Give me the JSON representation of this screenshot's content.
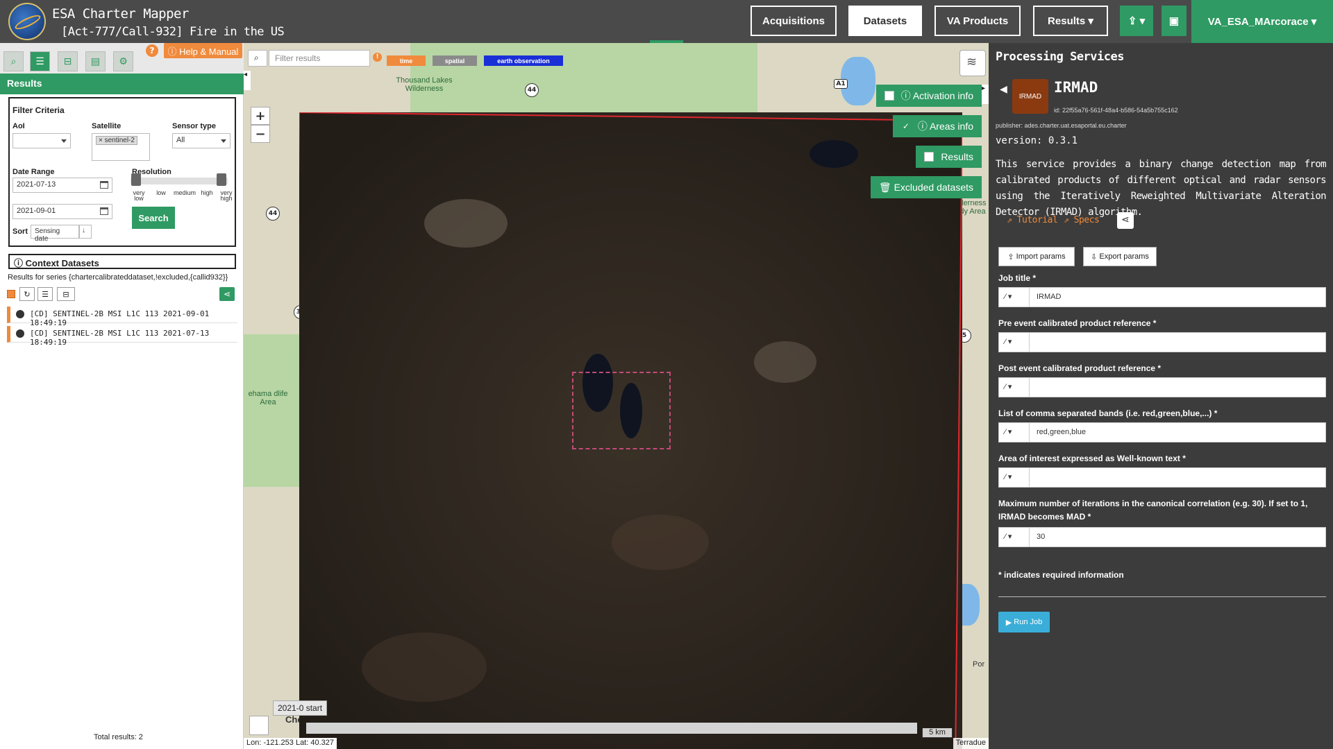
{
  "header": {
    "app_title": "ESA Charter Mapper",
    "activation_title": "[Act-777/Call-932] Fire in the US",
    "nav": {
      "acquisitions": "Acquisitions",
      "datasets": "Datasets",
      "va_products": "VA Products",
      "results": "Results ▾"
    },
    "upload_icon": "upload-icon",
    "briefcase_icon": "briefcase-icon",
    "user": "VA_ESA_MArcorace ▾"
  },
  "left_panel": {
    "help_label": "?",
    "help_manual": "ⓘ Help & Manual",
    "results_header": "Results",
    "filter": {
      "title": "Filter Criteria",
      "aoi_label": "AoI",
      "satellite_label": "Satellite",
      "satellite_value": "× sentinel-2",
      "sensor_label": "Sensor type",
      "sensor_value": "All",
      "date_range_label": "Date Range",
      "date_from": "2021-07-13",
      "date_to": "2021-09-01",
      "resolution_label": "Resolution",
      "resolution_ticks": [
        "very low",
        "low",
        "medium",
        "high",
        "very high"
      ],
      "sort_label": "Sort",
      "sort_value": "Sensing date",
      "sort_dir": "↓",
      "search_button": "Search"
    },
    "context_datasets": "ⓘ Context Datasets",
    "series_text": "Results for series {chartercalibrateddataset,!excluded,{callid932}}",
    "results": [
      "[CD] SENTINEL-2B MSI L1C 113 2021-09-01 18:49:19",
      "[CD] SENTINEL-2B MSI L1C 113 2021-07-13 18:49:19"
    ],
    "total_results": "Total results: 2"
  },
  "map": {
    "filter_placeholder": "Filter results",
    "tags": {
      "time": "time",
      "spatial": "spatial",
      "eo": "earth observation"
    },
    "zoom_in": "+",
    "zoom_out": "−",
    "toggles": {
      "activation_info": "ⓘ Activation info",
      "areas_info": "ⓘ Areas info",
      "results": "Results",
      "excluded": "🗑 Excluded datasets"
    },
    "labels": {
      "thousand_lakes": "Thousand Lakes Wilderness",
      "tehama": "ehama dlife Area",
      "wilderness_right": "derness dy Area",
      "chester": "Che",
      "por": "Por"
    },
    "roads": [
      "44",
      "44",
      "A1",
      "36",
      "5"
    ],
    "timeline_label": "2021-0 start",
    "coords": "Lon: -121.253 Lat: 40.327",
    "scale": "5 km",
    "attribution": "Terradue"
  },
  "right_panel": {
    "title": "Processing Services",
    "service": {
      "logo_text": "IRMAD",
      "name": "IRMAD",
      "id": "id: 22f55a76-561f-48a4-b586-54a5b755c162",
      "publisher": "publisher: ades.charter.uat.esaportal.eu.charter",
      "version": "version: 0.3.1",
      "description": "This service provides a binary change detection map from calibrated products of different optical and radar sensors using the Iteratively Reweighted Multivariate Alteration Detector (IRMAD) algorithm.",
      "tutorial": "Tutorial",
      "specs": "Specs"
    },
    "import_params": "Import params",
    "export_params": "Export params",
    "fields": [
      {
        "label": "Job title *",
        "value": "IRMAD"
      },
      {
        "label": "Pre event calibrated product reference *",
        "value": ""
      },
      {
        "label": "Post event calibrated product reference *",
        "value": ""
      },
      {
        "label": "List of comma separated bands (i.e. red,green,blue,...) *",
        "value": "red,green,blue"
      },
      {
        "label": "Area of interest expressed as Well-known text *",
        "value": ""
      },
      {
        "label": "Maximum number of iterations in the canonical correlation (e.g. 30). If set to 1, IRMAD becomes MAD *",
        "value": "30"
      }
    ],
    "required_note": "* indicates required information",
    "run_job": "Run Job"
  },
  "colors": {
    "accent_green": "#2f9a63",
    "orange": "#f08a3c",
    "header_bg": "#4a4a4a",
    "panel_dark": "#3c3c3c",
    "run_blue": "#3aaed8"
  }
}
